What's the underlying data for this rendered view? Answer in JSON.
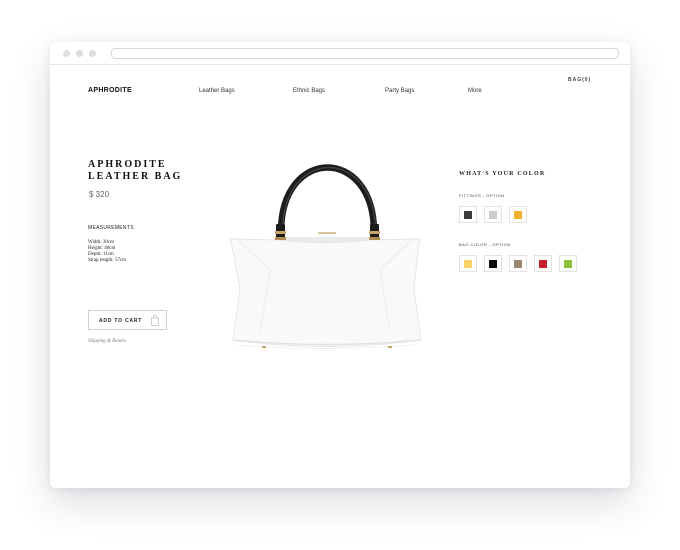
{
  "header": {
    "logo": "APHRODITE",
    "nav": [
      "Leather Bags",
      "Ethnic Bags",
      "Party Bags",
      "More"
    ],
    "bag_link": "BAG(0)"
  },
  "product": {
    "title_line1": "APHRODITE",
    "title_line2": "LEATHER BAG",
    "price": "$ 320",
    "measurements_heading": "MEASUREMENTS",
    "measurements": [
      "Width: 30cm",
      "Height: 40cm",
      "Depth: 11cm",
      "Strap length: 57cm"
    ],
    "add_to_cart": "ADD TO CART",
    "shipping_link": "Shipping & Return"
  },
  "colors": {
    "heading": "WHAT'S YOUR COLOR",
    "fittings_label": "FITTINGS - OPTION",
    "fittings": [
      "#3a3a3a",
      "#cccccc",
      "#f5b02e"
    ],
    "bag_color_label": "BAG COLOR - OPTION",
    "bag_colors": [
      "#f7d36a",
      "#0d0d0d",
      "#9a8874",
      "#c8202a",
      "#8cc43e"
    ]
  },
  "icons": {
    "cart": "shopping-bag-icon"
  }
}
